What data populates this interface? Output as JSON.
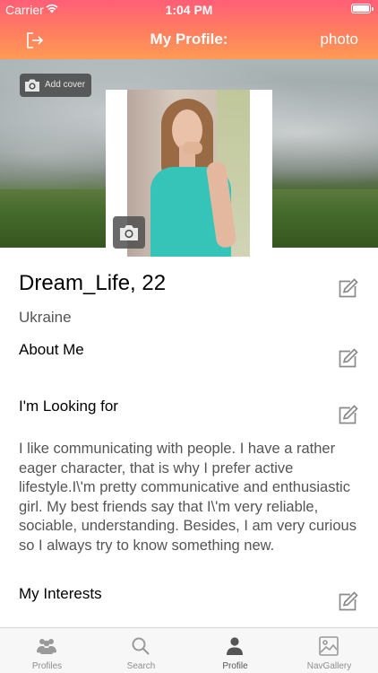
{
  "status_bar": {
    "carrier": "Carrier",
    "time": "1:04 PM"
  },
  "nav": {
    "title": "My Profile:",
    "right_button": "photo"
  },
  "cover": {
    "add_cover_label": "Add cover"
  },
  "profile": {
    "name_age": "Dream_Life, 22",
    "country": "Ukraine",
    "about_title": "About Me",
    "looking_title": "I'm Looking for",
    "bio": " I like communicating with people. I have a rather eager character, that is why I prefer active lifestyle.I\\'m pretty communicative and enthusiastic girl. My best friends say that I\\'m very reliable, sociable, understanding. Besides, I am very curious so I always try to know something new.",
    "interests_title": "My Interests"
  },
  "tabs": [
    {
      "label": "Profiles",
      "icon": "people-icon"
    },
    {
      "label": "Search",
      "icon": "search-icon"
    },
    {
      "label": "Profile",
      "icon": "person-icon",
      "active": true
    },
    {
      "label": "NavGallery",
      "icon": "gallery-icon"
    }
  ],
  "colors": {
    "gradient_top": "#ff5e77",
    "gradient_bottom": "#ff9a55",
    "text_secondary": "#555555",
    "tab_inactive": "#8e8e8e"
  }
}
